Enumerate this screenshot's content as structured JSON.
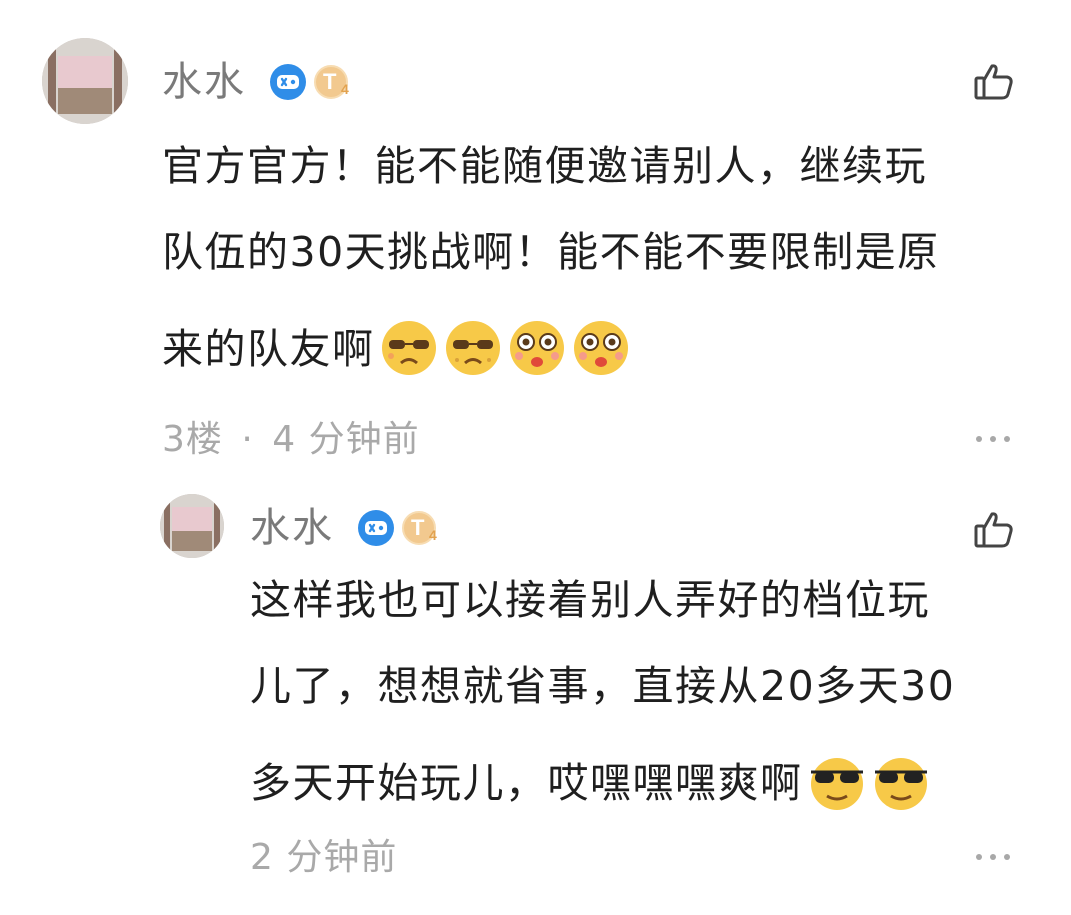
{
  "comments": [
    {
      "username": "水水",
      "level": "4",
      "lines": [
        "官方官方！能不能随便邀请别人，继续玩",
        "队伍的30天挑战啊！能不能不要限制是原",
        "来的队友啊"
      ],
      "emojis": [
        "sweat-sad-emoji",
        "sweat-sad-emoji",
        "crying-emoji",
        "crying-emoji"
      ],
      "floor": "3楼",
      "separator": "·",
      "time": "4 分钟前"
    },
    {
      "username": "水水",
      "level": "4",
      "lines": [
        "这样我也可以接着别人弄好的档位玩",
        "儿了，想想就省事，直接从20多天30",
        "多天开始玩儿，哎嘿嘿嘿爽啊"
      ],
      "emojis": [
        "sunglasses-emoji",
        "sunglasses-emoji"
      ],
      "time": "2 分钟前"
    }
  ],
  "colors": {
    "username": "#7a7a7a",
    "text": "#1f1f1f",
    "meta": "#a9a9a9",
    "game_badge": "#2f8de8",
    "level_badge": "#f2c98f"
  }
}
